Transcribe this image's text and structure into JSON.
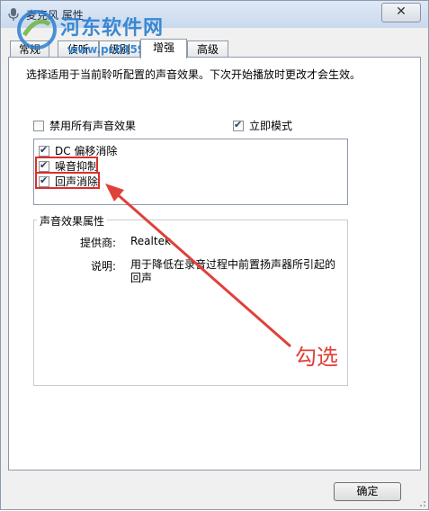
{
  "window": {
    "title": "麦克风 属性",
    "close_label": "✕"
  },
  "watermark": {
    "text": "河东软件网",
    "url": "www.pc0359.cn"
  },
  "tabs": [
    {
      "label": "常规",
      "active": false
    },
    {
      "label": "侦听",
      "active": false
    },
    {
      "label": "级别",
      "active": false
    },
    {
      "label": "增强",
      "active": true
    },
    {
      "label": "高级",
      "active": false
    }
  ],
  "enhance": {
    "description": "选择适用于当前聆听配置的声音效果。下次开始播放时更改才会生效。",
    "disable_all": {
      "label": "禁用所有声音效果",
      "checked": false
    },
    "immediate_mode": {
      "label": "立即模式",
      "checked": true
    },
    "effects": [
      {
        "label": "DC 偏移消除",
        "checked": true
      },
      {
        "label": "噪音抑制",
        "checked": true
      },
      {
        "label": "回声消除",
        "checked": true
      }
    ],
    "properties": {
      "group_title": "声音效果属性",
      "provider_label": "提供商:",
      "provider_value": "Realtek",
      "description_label": "说明:",
      "description_value": "用于降低在录音过程中前置扬声器所引起的回声"
    }
  },
  "annotation": {
    "text": "勾选",
    "color": "#e0403a"
  },
  "buttons": {
    "ok": "确定"
  }
}
